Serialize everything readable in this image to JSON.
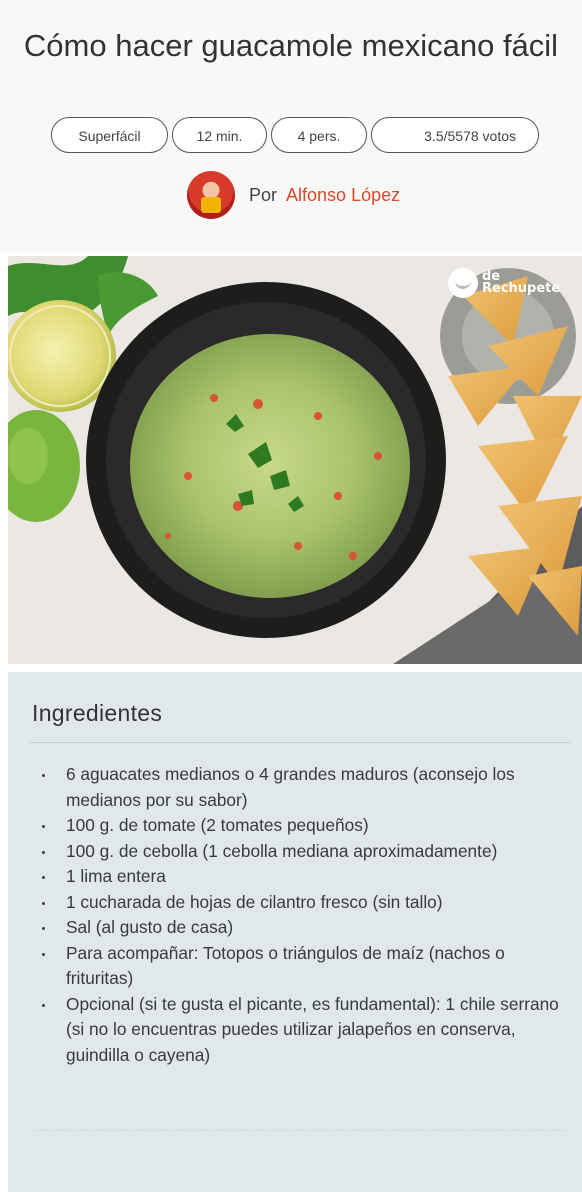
{
  "top_fragment": "guacamole",
  "recipe": {
    "title": "Cómo hacer guacamole mexicano fácil",
    "difficulty": "Superfácil",
    "time": "12 min.",
    "servings": "4 pers.",
    "rating": "3.5/5578 votos",
    "by_label": "Por",
    "author": "Alfonso López"
  },
  "image": {
    "watermark_top": "de",
    "watermark_bottom": "Rechupete"
  },
  "ingredients": {
    "title": "Ingredientes",
    "items": [
      "6 aguacates medianos o 4 grandes maduros (aconsejo los medianos por su sabor)",
      "100 g. de tomate (2 tomates pequeños)",
      "100 g. de cebolla (1 cebolla mediana aproximadamente)",
      "1 lima entera",
      "1 cucharada de hojas de cilantro fresco (sin tallo)",
      "Sal (al gusto de casa)",
      "Para acompañar: Totopos o triángulos de maíz (nachos o frituritas)",
      "Opcional (si te gusta el picante, es fundamental): 1 chile serrano (si no lo encuentras puedes utilizar jalapeños en conserva, guindilla o cayena)"
    ]
  },
  "colors": {
    "header_bg": "#f8f8f8",
    "author_link": "#d9492b",
    "ingredients_bg": "#e1e8ec"
  }
}
